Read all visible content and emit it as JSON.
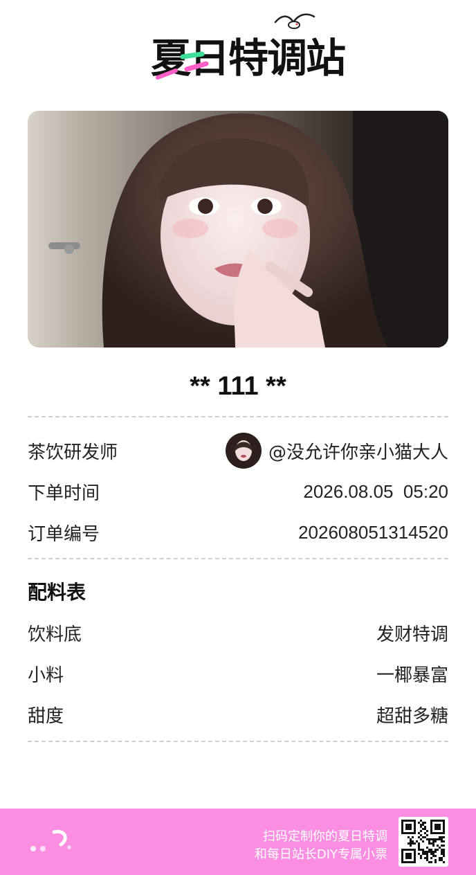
{
  "header": {
    "logo_text": "夏日特调站"
  },
  "order": {
    "title": "** 111 **"
  },
  "info": {
    "maker_label": "茶饮研发师",
    "maker_handle": "@没允许你亲小猫大人",
    "time_label": "下单时间",
    "time_value": "2026.08.05  05:20",
    "number_label": "订单编号",
    "number_value": "202608051314520"
  },
  "recipe": {
    "title": "配料表",
    "items": [
      {
        "label": "饮料底",
        "value": "发财特调"
      },
      {
        "label": "小料",
        "value": "一椰暴富"
      },
      {
        "label": "甜度",
        "value": "超甜多糖"
      }
    ]
  },
  "footer": {
    "line1": "扫码定制你的夏日特调",
    "line2": "和每日站长DIY专属小票"
  },
  "colors": {
    "footer_bg": "#fb8ee0",
    "logo_green": "#3ddc97",
    "logo_pink": "#ff5ec8",
    "divider": "#cfcfcf"
  },
  "icons": {
    "seagull": "seagull-icon",
    "avatar": "avatar",
    "qr": "qr-code"
  }
}
